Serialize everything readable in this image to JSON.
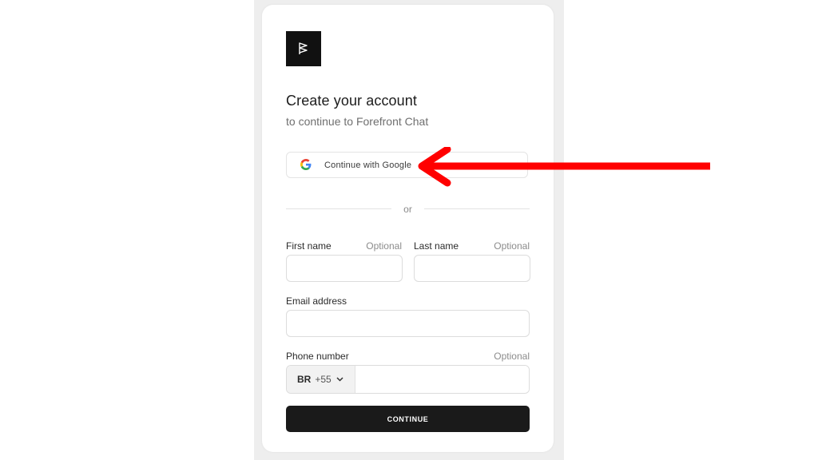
{
  "signup": {
    "title": "Create your account",
    "subtitle": "to continue to Forefront Chat",
    "google_button": {
      "label": "Continue with Google",
      "icon": "google-g-icon"
    },
    "divider_text": "or",
    "fields": {
      "first_name": {
        "label": "First name",
        "optional": "Optional",
        "value": ""
      },
      "last_name": {
        "label": "Last name",
        "optional": "Optional",
        "value": ""
      },
      "email": {
        "label": "Email address",
        "value": ""
      },
      "phone": {
        "label": "Phone number",
        "optional": "Optional",
        "country_code": "BR",
        "dial_code": "+55",
        "value": ""
      }
    },
    "continue_label": "CONTINUE"
  },
  "annotation": {
    "arrow_color": "#ff0000",
    "points_to": "google-signin-button"
  },
  "colors": {
    "primary_button": "#1a1a1a",
    "backdrop": "#eeeeee",
    "logo_bg": "#111111"
  }
}
